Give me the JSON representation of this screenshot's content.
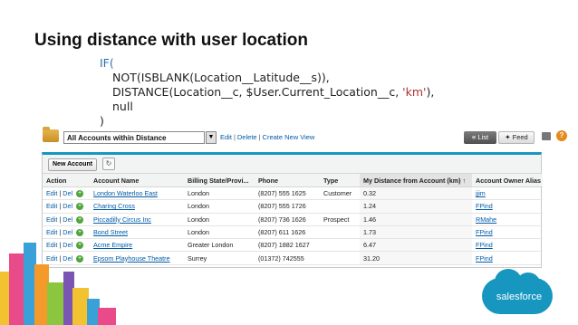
{
  "slide": {
    "title": "Using distance with user location",
    "formula": {
      "line1": "IF(",
      "line2": "NOT(ISBLANK(Location__Latitude__s)),",
      "line3_pre": "DISTANCE(Location__c, $User.Current_Location__c, ",
      "line3_str": "'km'",
      "line3_post": "),",
      "line4": "null",
      "line5": ")"
    }
  },
  "toolbar": {
    "view_name": "All Accounts within Distance",
    "edit_link": "Edit",
    "delete_link": "Delete",
    "create_link": "Create New View",
    "list_button": "List",
    "feed_button": "Feed",
    "print_icon": "printer-icon",
    "help_icon": "help-icon"
  },
  "list": {
    "new_button": "New Account",
    "refresh_icon": "refresh-icon",
    "columns": [
      "Action",
      "Account Name",
      "Billing State/Provi...",
      "Phone",
      "Type",
      "My Distance from Account (km) ↑",
      "Account Owner Alias"
    ],
    "rows": [
      {
        "action_edit": "Edit",
        "action_del": "Del",
        "name": "London Waterloo East",
        "state": "London",
        "phone": "(8207) 555 1625",
        "type": "Customer",
        "distance": "0.32",
        "owner": "jjim"
      },
      {
        "action_edit": "Edit",
        "action_del": "Del",
        "name": "Charing Cross",
        "state": "London",
        "phone": "(8207) 555 1726",
        "type": "",
        "distance": "1.24",
        "owner": "FPind"
      },
      {
        "action_edit": "Edit",
        "action_del": "Del",
        "name": "Piccadilly Circus Inc",
        "state": "London",
        "phone": "(8207) 736 1626",
        "type": "Prospect",
        "distance": "1.46",
        "owner": "RMahe"
      },
      {
        "action_edit": "Edit",
        "action_del": "Del",
        "name": "Bond Street",
        "state": "London",
        "phone": "(8207) 611 1626",
        "type": "",
        "distance": "1.73",
        "owner": "FPind"
      },
      {
        "action_edit": "Edit",
        "action_del": "Del",
        "name": "Acme Empire",
        "state": "Greater London",
        "phone": "(8207) 1882 1627",
        "type": "",
        "distance": "6.47",
        "owner": "FPind"
      },
      {
        "action_edit": "Edit",
        "action_del": "Del",
        "name": "Epsom Playhouse Theatre",
        "state": "Surrey",
        "phone": "(01372) 742555",
        "type": "",
        "distance": "31.20",
        "owner": "FPind"
      }
    ]
  },
  "branding": {
    "logo_text": "salesforce"
  },
  "colors": {
    "accent": "#1797c0",
    "link": "#015ba7",
    "add": "#4fa43a"
  }
}
